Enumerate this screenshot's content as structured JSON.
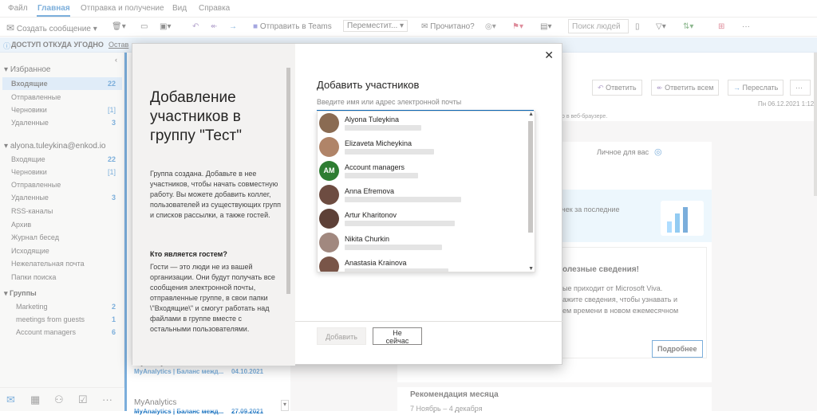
{
  "menu": {
    "items": [
      "Файл",
      "Главная",
      "Отправка и получение",
      "Вид",
      "Справка"
    ],
    "active": "Главная"
  },
  "ribbon": {
    "new_message": "Создать сообщение",
    "send_teams": "Отправить в Teams",
    "move": "Переместит...",
    "read": "Прочитано?",
    "search_people": "Поиск людей"
  },
  "infobar": {
    "title": "ДОСТУП ОТКУДА УГОДНО",
    "link": "Остав"
  },
  "favorites": {
    "header": "Избранное",
    "items": [
      {
        "label": "Входящие",
        "count": "22",
        "bold": true
      },
      {
        "label": "Отправленные",
        "count": ""
      },
      {
        "label": "Черновики",
        "count": "[1]"
      },
      {
        "label": "Удаленные",
        "count": "3"
      }
    ]
  },
  "account": {
    "header": "alyona.tuleykina@enkod.io",
    "items": [
      {
        "label": "Входящие",
        "count": "22"
      },
      {
        "label": "Черновики",
        "count": "[1]"
      },
      {
        "label": "Отправленные",
        "count": ""
      },
      {
        "label": "Удаленные",
        "count": "3"
      },
      {
        "label": "RSS-каналы",
        "count": ""
      },
      {
        "label": "Архив",
        "count": ""
      },
      {
        "label": "Журнал бесед",
        "count": ""
      },
      {
        "label": "Исходящие",
        "count": ""
      },
      {
        "label": "Нежелательная почта",
        "count": ""
      },
      {
        "label": "Папки поиска",
        "count": ""
      }
    ]
  },
  "groups": {
    "header": "Группы",
    "items": [
      {
        "label": "Marketing",
        "count": "2"
      },
      {
        "label": "meetings from guests",
        "count": "1"
      },
      {
        "label": "Account managers",
        "count": "6"
      }
    ]
  },
  "messages": [
    {
      "sender": "MyAnalytics",
      "subject": "MyAnalytics | Баланс межд...",
      "date": "04.10.2021"
    },
    {
      "sender": "MyAnalytics",
      "subject": "MyAnalytics | Баланс межд...",
      "date": "27.09.2021"
    }
  ],
  "reading": {
    "reply": "Ответить",
    "reply_all": "Ответить всем",
    "forward": "Переслать",
    "date": "Пн 06.12.2021 1:12",
    "browser_note": "о в веб-браузере.",
    "personal": "Личное для вас",
    "last": "чек за последние",
    "useful": "олезные сведения!",
    "line1": "ые приходит от Microsoft Viva.",
    "line2": "ажите сведения, чтобы узнавать и",
    "line3": "ем времени в новом ежемесячном",
    "more": "Подробнее",
    "reco": "Рекомендация месяца",
    "reco_date": "7 Ноябрь – 4 декабря"
  },
  "dialog": {
    "title": "Добавление участников в группу \"Тест\"",
    "intro": "Группа создана. Добавьте в нее участников, чтобы начать совместную работу. Вы можете добавить коллег, пользователей из существующих групп и списков рассылки, а также гостей.",
    "guest_head": "Кто является гостем?",
    "guest_text": "Гости — это люди не из вашей организации. Они будут получать все сообщения электронной почты, отправленные группе, в свои папки \\\"Входящие\\\" и смогут работать над файлами в группе вместе с остальными пользователями.",
    "add_title": "Добавить участников",
    "input_placeholder": "Введите имя или адрес электронной почты",
    "people": [
      {
        "name": "Alyona Tuleykina",
        "avatar": "#8a6b52"
      },
      {
        "name": "Elizaveta Micheykina",
        "avatar": "#b08468"
      },
      {
        "name": "Account managers",
        "avatar": "#2e7d32",
        "initials": "AM"
      },
      {
        "name": "Anna Efremova",
        "avatar": "#6d4c41"
      },
      {
        "name": "Artur Kharitonov",
        "avatar": "#5d4037"
      },
      {
        "name": "Nikita Churkin",
        "avatar": "#a1887f"
      },
      {
        "name": "Anastasia Krainova",
        "avatar": "#795548"
      }
    ],
    "add_button": "Добавить",
    "not_now_button": "Не сейчас"
  }
}
